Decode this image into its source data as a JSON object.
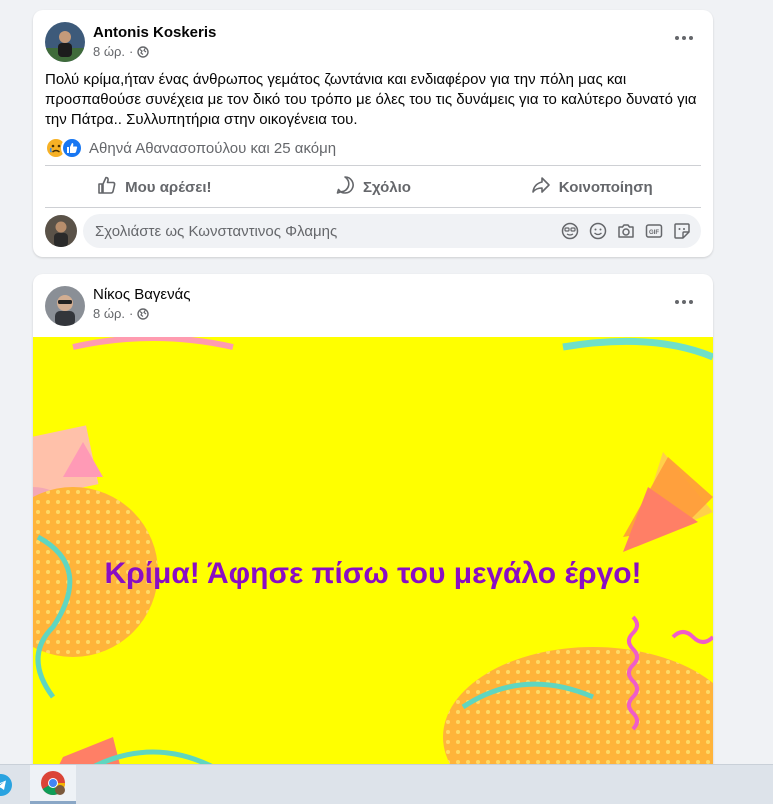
{
  "post1": {
    "author": "Antonis Koskeris",
    "time": "8 ώρ.",
    "separator": "·",
    "text": "Πολύ κρίμα,ήταν ένας άνθρωπος γεμάτος ζωντάνια και ενδιαφέρον για την πόλη μας και προσπαθούσε συνέχεια με τον δικό του τρόπο με όλες του τις δυνάμεις για το καλύτερο δυνατό για την Πάτρα.. Συλλυπητήρια στην οικογένεια του.",
    "reactions_text": "Αθηνά Αθανασοπούλου και 25 ακόμη",
    "actions": {
      "like": "Μου αρέσει!",
      "comment": "Σχόλιο",
      "share": "Κοινοποίηση"
    },
    "comment_placeholder": "Σχολιάστε ως Κωνσταντινος Φλαμης",
    "gif_label": "GIF"
  },
  "post2": {
    "author": "Νίκος Βαγενάς",
    "time": "8 ώρ.",
    "separator": "·",
    "image_text": "Κρίμα! Άφησε πίσω του μεγάλο έργο!"
  },
  "colors": {
    "facebook_blue": "#1877f2",
    "banner_yellow": "#ffff00",
    "banner_text": "#8a0dc4",
    "secondary_text": "#65676b"
  },
  "icons": {
    "like": "thumbs-up-icon",
    "comment": "speech-bubble-icon",
    "share": "share-arrow-icon",
    "privacy": "globe-icon",
    "taskbar": [
      "telegram-icon",
      "chrome-icon"
    ]
  }
}
